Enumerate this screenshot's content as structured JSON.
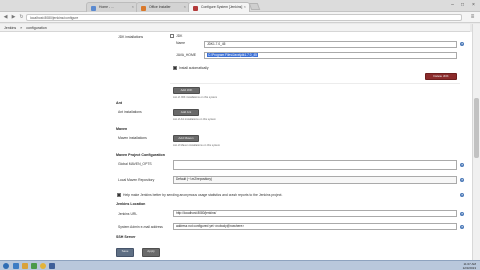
{
  "browser": {
    "tabs": [
      {
        "label": "Home - ..."
      },
      {
        "label": "Office Installer"
      },
      {
        "label": "Configure System [Jenkins]"
      }
    ],
    "url": "localhost:8080/jenkins/configure"
  },
  "breadcrumb": {
    "items": [
      "Jenkins",
      "»",
      "configuration"
    ]
  },
  "jdk": {
    "section_label": "JDK installations",
    "sub_label": "JDK",
    "name_label": "Name",
    "name_value": "JDK1.7.0_45",
    "java_home_label": "JAVA_HOME",
    "java_home_value": "C:\\Program Files\\Java\\jdk1.7.0_45",
    "install_auto_label": "Install automatically",
    "delete_button": "Delete JDK",
    "add_button": "Add JDK",
    "list_note": "List of JDK installations on this system"
  },
  "ant": {
    "section_label": "Ant",
    "installations_label": "Ant installations",
    "add_button": "Add Ant",
    "list_note": "List of Ant installations on this system"
  },
  "maven": {
    "section_label": "Maven",
    "installations_label": "Maven installations",
    "add_button": "Add Maven",
    "list_note": "List of Maven installations on this system"
  },
  "maven_project": {
    "section_label": "Maven Project Configuration",
    "opts_label": "Global MAVEN_OPTS",
    "opts_value": "",
    "local_repo_label": "Local Maven Repository",
    "local_repo_value": "Default (~/.m2/repository)"
  },
  "usage": {
    "label": "Help make Jenkins better by sending anonymous usage statistics and crash reports to the Jenkins project."
  },
  "location": {
    "section_label": "Jenkins Location",
    "url_label": "Jenkins URL",
    "url_value": "http://localhost:8080/jenkins/",
    "email_label": "System Admin e-mail address",
    "email_value": "address not configured yet <nobody@nowhere>"
  },
  "ssh": {
    "section_label": "SSH Server"
  },
  "footer": {
    "save_button": "Save",
    "apply_button": "Apply"
  },
  "taskbar": {
    "time": "11:07 AM",
    "date": "12/3/2013"
  },
  "colors": {
    "delete_button": "#8b2b2b",
    "help_icon": "#4a78b7",
    "taskbar": "#b9c8dc"
  }
}
